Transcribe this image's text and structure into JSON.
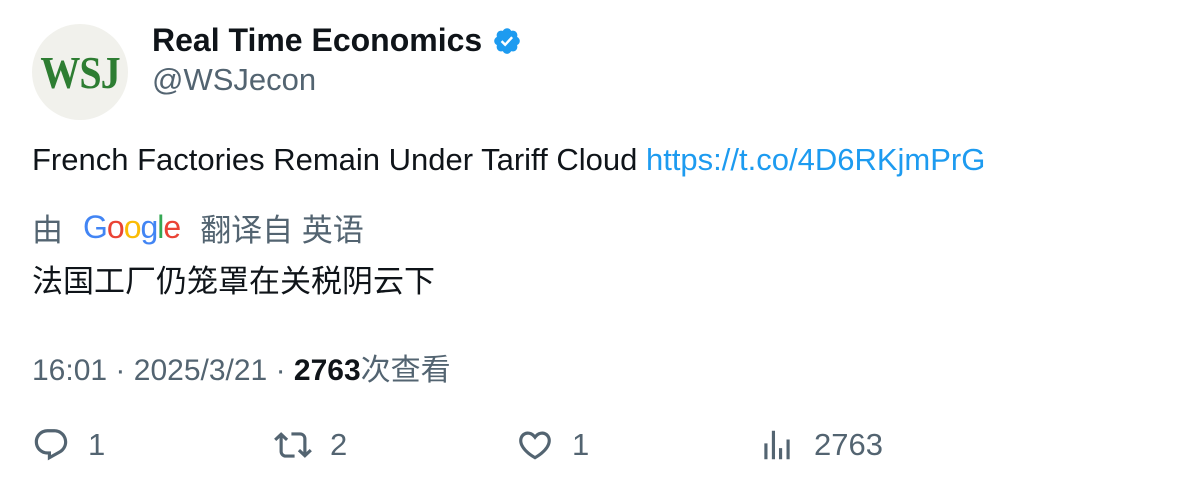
{
  "author": {
    "avatar_text": "WSJ",
    "display_name": "Real Time Economics",
    "handle": "@WSJecon",
    "verified": true
  },
  "tweet": {
    "text": "French Factories Remain Under Tariff Cloud",
    "link": "https://t.co/4D6RKjmPrG"
  },
  "translation": {
    "prefix": "由",
    "provider": "Google",
    "suffix": "翻译自 英语",
    "text": "法国工厂仍笼罩在关税阴云下"
  },
  "meta": {
    "time": "16:01",
    "separator": "·",
    "date": "2025/3/21",
    "views_count": "2763",
    "views_label": "次查看"
  },
  "actions": {
    "replies": "1",
    "retweets": "2",
    "likes": "1",
    "views": "2763"
  },
  "colors": {
    "link": "#1d9bf0",
    "secondary_text": "#536471",
    "verified": "#1d9bf0"
  }
}
